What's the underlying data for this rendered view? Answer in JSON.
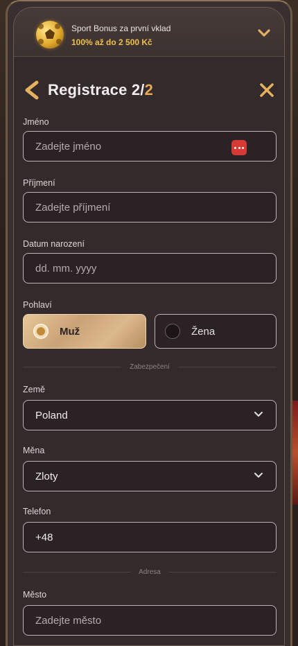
{
  "bonus": {
    "title": "Sport Bonus za první vklad",
    "subtitle": "100% až do 2 500 Kč"
  },
  "header": {
    "title": "Registrace 2/",
    "step_total": "2"
  },
  "form": {
    "first_name": {
      "label": "Jméno",
      "placeholder": "Zadejte jméno"
    },
    "last_name": {
      "label": "Příjmení",
      "placeholder": "Zadejte příjmení"
    },
    "birth_date": {
      "label": "Datum narození",
      "placeholder": "dd. mm. yyyy"
    },
    "gender": {
      "label": "Pohlaví",
      "male": "Muž",
      "female": "Žena",
      "selected": "Muž"
    },
    "section_security": "Zabezpečení",
    "country": {
      "label": "Země",
      "value": "Poland"
    },
    "currency": {
      "label": "Měna",
      "value": "Zloty"
    },
    "phone": {
      "label": "Telefon",
      "value": "+48"
    },
    "section_address": "Adresa",
    "city": {
      "label": "Město",
      "placeholder": "Zadejte město"
    }
  },
  "colors": {
    "accent": "#e4aa55",
    "bonus_highlight": "#f0c04d",
    "modal_bg": "#332a2c",
    "password_badge": "#d63a35"
  },
  "icons": [
    "soccer-ball-icon",
    "chevron-down-icon",
    "back-arrow-icon",
    "close-icon",
    "password-dots-icon"
  ]
}
